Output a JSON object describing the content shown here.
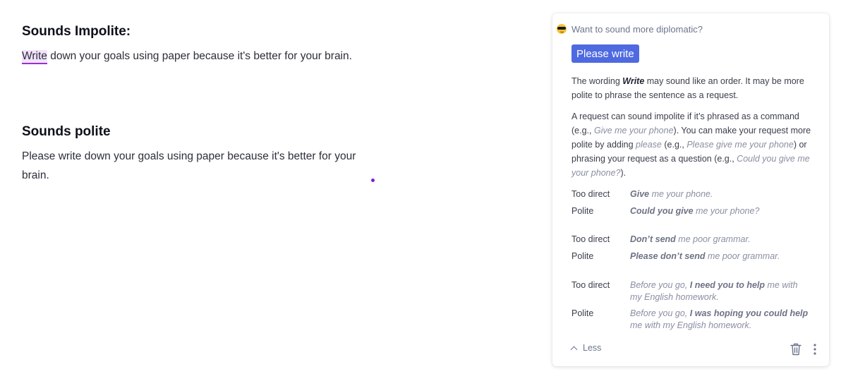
{
  "doc": {
    "impolite_heading": "Sounds Impolite:",
    "impolite_highlight": "Write",
    "impolite_rest": " down your goals using paper because it's better for your brain.",
    "polite_heading": "Sounds polite",
    "polite_text": "Please write down your goals using paper because it's better for your brain."
  },
  "card": {
    "prompt": "Want to sound more diplomatic?",
    "suggestion_button": "Please write",
    "para1": {
      "a": "The wording ",
      "word": "Write",
      "b": " may sound like an order. It may be more polite to phrase the sentence as a request."
    },
    "para2": {
      "a": "A request can sound impolite if it’s phrased as a command (e.g., ",
      "ex1": "Give me your phone",
      "b": "). You can make your request more polite by adding ",
      "ex2": "please",
      "c": " (e.g., ",
      "ex3": "Please give me your phone",
      "d": ") or phrasing your request as a question (e.g., ",
      "ex4": "Could you give me your phone?",
      "e": ")."
    },
    "examples": [
      {
        "label": "Too direct",
        "bold": "Give",
        "rest": " me your phone."
      },
      {
        "label": "Polite",
        "bold": "Could you give",
        "rest": " me your phone?"
      },
      {
        "label": "Too direct",
        "bold": "Don’t send",
        "rest": " me poor grammar."
      },
      {
        "label": "Polite",
        "bold": "Please don’t send",
        "rest": " me poor grammar."
      },
      {
        "label": "Too direct",
        "pre": "Before you go, ",
        "bold": "I need you to help",
        "rest": " me with my English homework."
      },
      {
        "label": "Polite",
        "pre": "Before you go, ",
        "bold": "I was hoping you could help",
        "rest": " me with my English homework."
      }
    ],
    "less_label": "Less",
    "emoji_icon": "smiling-face-with-sunglasses",
    "accent_color": "#4f6ae0",
    "highlight_color": "#9b2fd1"
  }
}
